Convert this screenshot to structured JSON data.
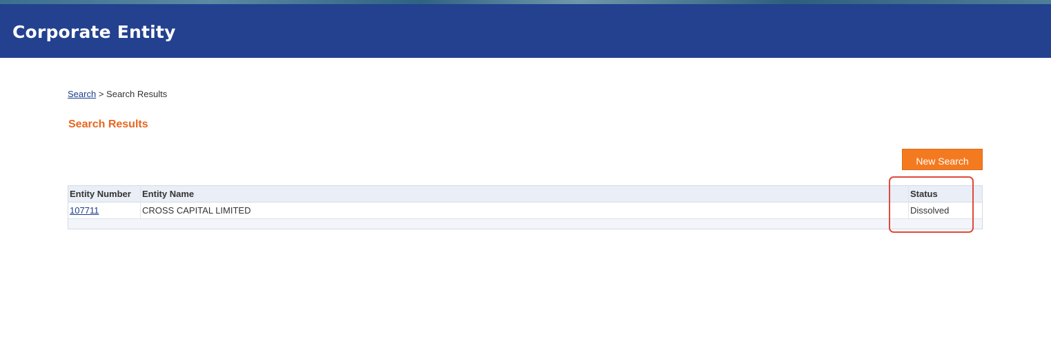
{
  "header": {
    "title": "Corporate Entity"
  },
  "breadcrumb": {
    "link_label": "Search",
    "separator": ">",
    "current": "Search Results"
  },
  "results": {
    "heading": "Search Results",
    "new_search_label": "New Search",
    "columns": [
      "Entity Number",
      "Entity Name",
      "Status"
    ],
    "rows": [
      {
        "entity_number": "107711",
        "entity_name": "CROSS CAPITAL LIMITED",
        "status": "Dissolved"
      }
    ]
  },
  "colors": {
    "header_bg": "#23418f",
    "accent_orange": "#f47a20",
    "heading_orange": "#e8661f",
    "annotation_red": "#e0483c"
  }
}
